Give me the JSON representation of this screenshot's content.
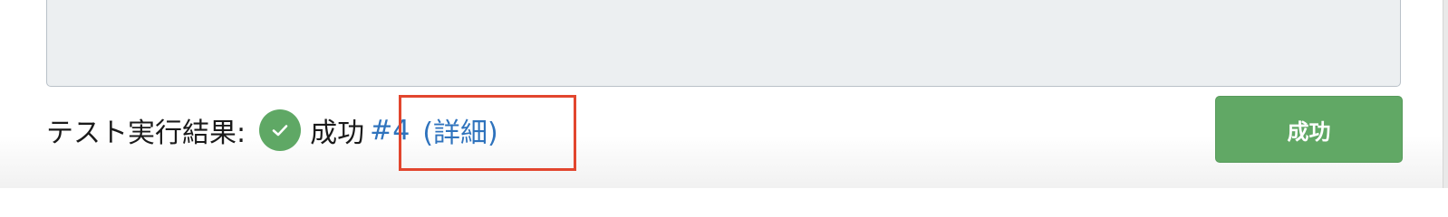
{
  "test_result": {
    "label": "テスト実行結果:",
    "status_icon": "check-circle-icon",
    "status_text": "成功",
    "run_link_text": "#4",
    "detail_link_text": "(詳細)"
  },
  "status_button": {
    "label": "成功"
  },
  "colors": {
    "success_green": "#61a865",
    "link_blue": "#2f73bd",
    "highlight_red": "#e2462e",
    "textarea_bg": "#eceff1"
  }
}
